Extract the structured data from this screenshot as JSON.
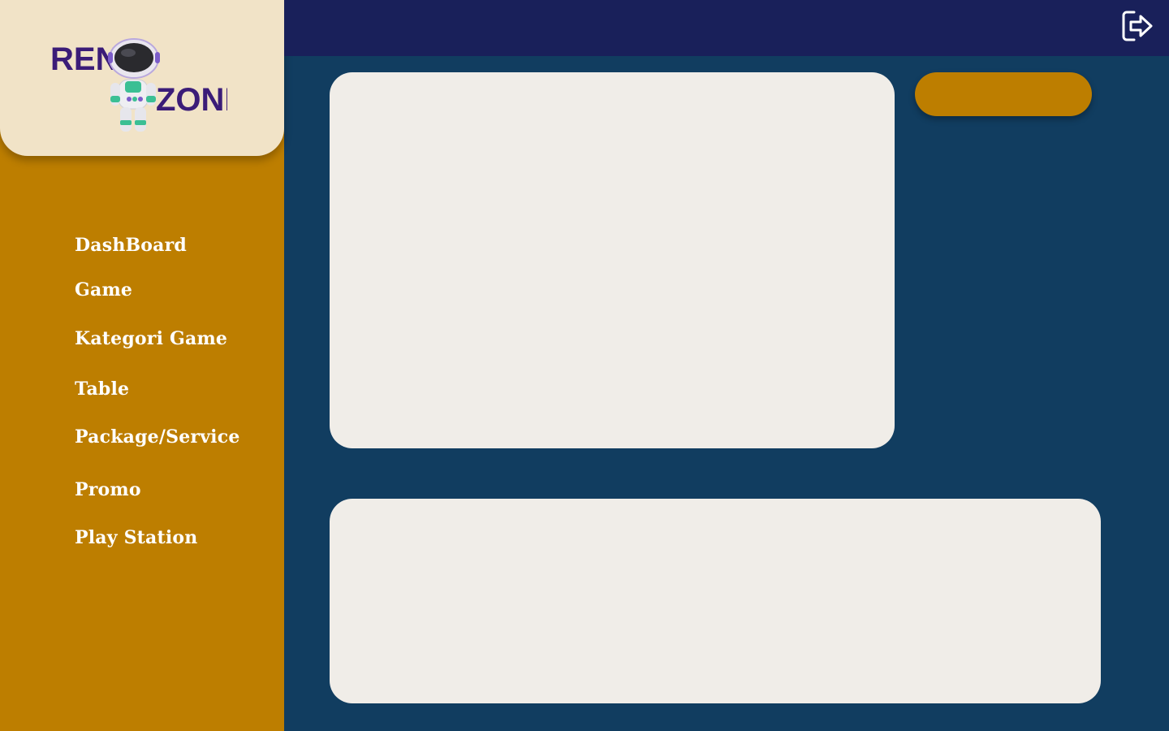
{
  "brand": {
    "logo_text_top": "REN",
    "logo_text_bottom": "ZONE"
  },
  "sidebar": {
    "items": [
      {
        "label": "DashBoard"
      },
      {
        "label": "Game"
      },
      {
        "label": "Kategori Game"
      },
      {
        "label": "Table"
      },
      {
        "label": "Package/Service"
      },
      {
        "label": "Promo"
      },
      {
        "label": "Play Station"
      }
    ]
  },
  "header": {
    "logout_icon": "logout-icon"
  },
  "main": {
    "primary_button_label": ""
  },
  "colors": {
    "sidebar": "#bd7e00",
    "logo_card": "#f1e3c7",
    "topbar": "#19205a",
    "background": "#113d60",
    "panel": "#f0ede8",
    "logo_text": "#3b1c78"
  }
}
